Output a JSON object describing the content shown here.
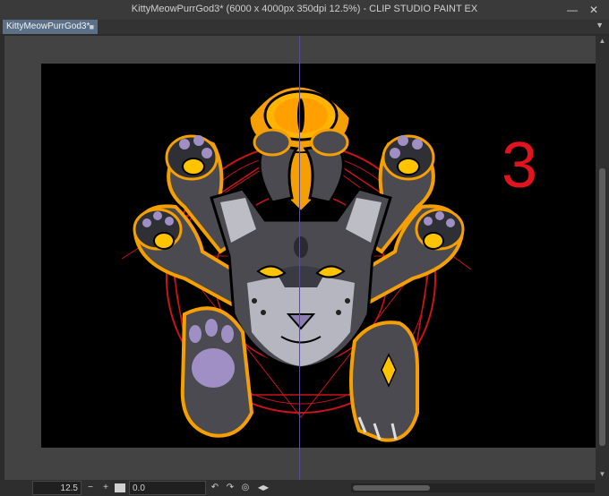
{
  "window": {
    "title": "KittyMeowPurrGod3* (6000 x 4000px 350dpi 12.5%)  - CLIP STUDIO PAINT EX",
    "minimize": "—",
    "close": "✕"
  },
  "tabs": [
    {
      "label": "KittyMeowPurrGod3*",
      "close": "■"
    }
  ],
  "tab_menu": "▼",
  "canvas": {
    "annotation": "3",
    "colors": {
      "background": "#000000",
      "circle_red": "#c8141b",
      "accent_orange": "#f5a000",
      "body_gray": "#4a4a50",
      "paw_purple": "#9f8fc4",
      "eye_yellow": "#ffc400"
    }
  },
  "status": {
    "zoom": "12.5",
    "zoom_out": "−",
    "zoom_in": "+",
    "angle": "0.0",
    "rotate_left": "↶",
    "rotate_right": "↷",
    "reset": "◎",
    "flip": "◀▶"
  },
  "scroll": {
    "up": "▲",
    "down": "▼"
  }
}
